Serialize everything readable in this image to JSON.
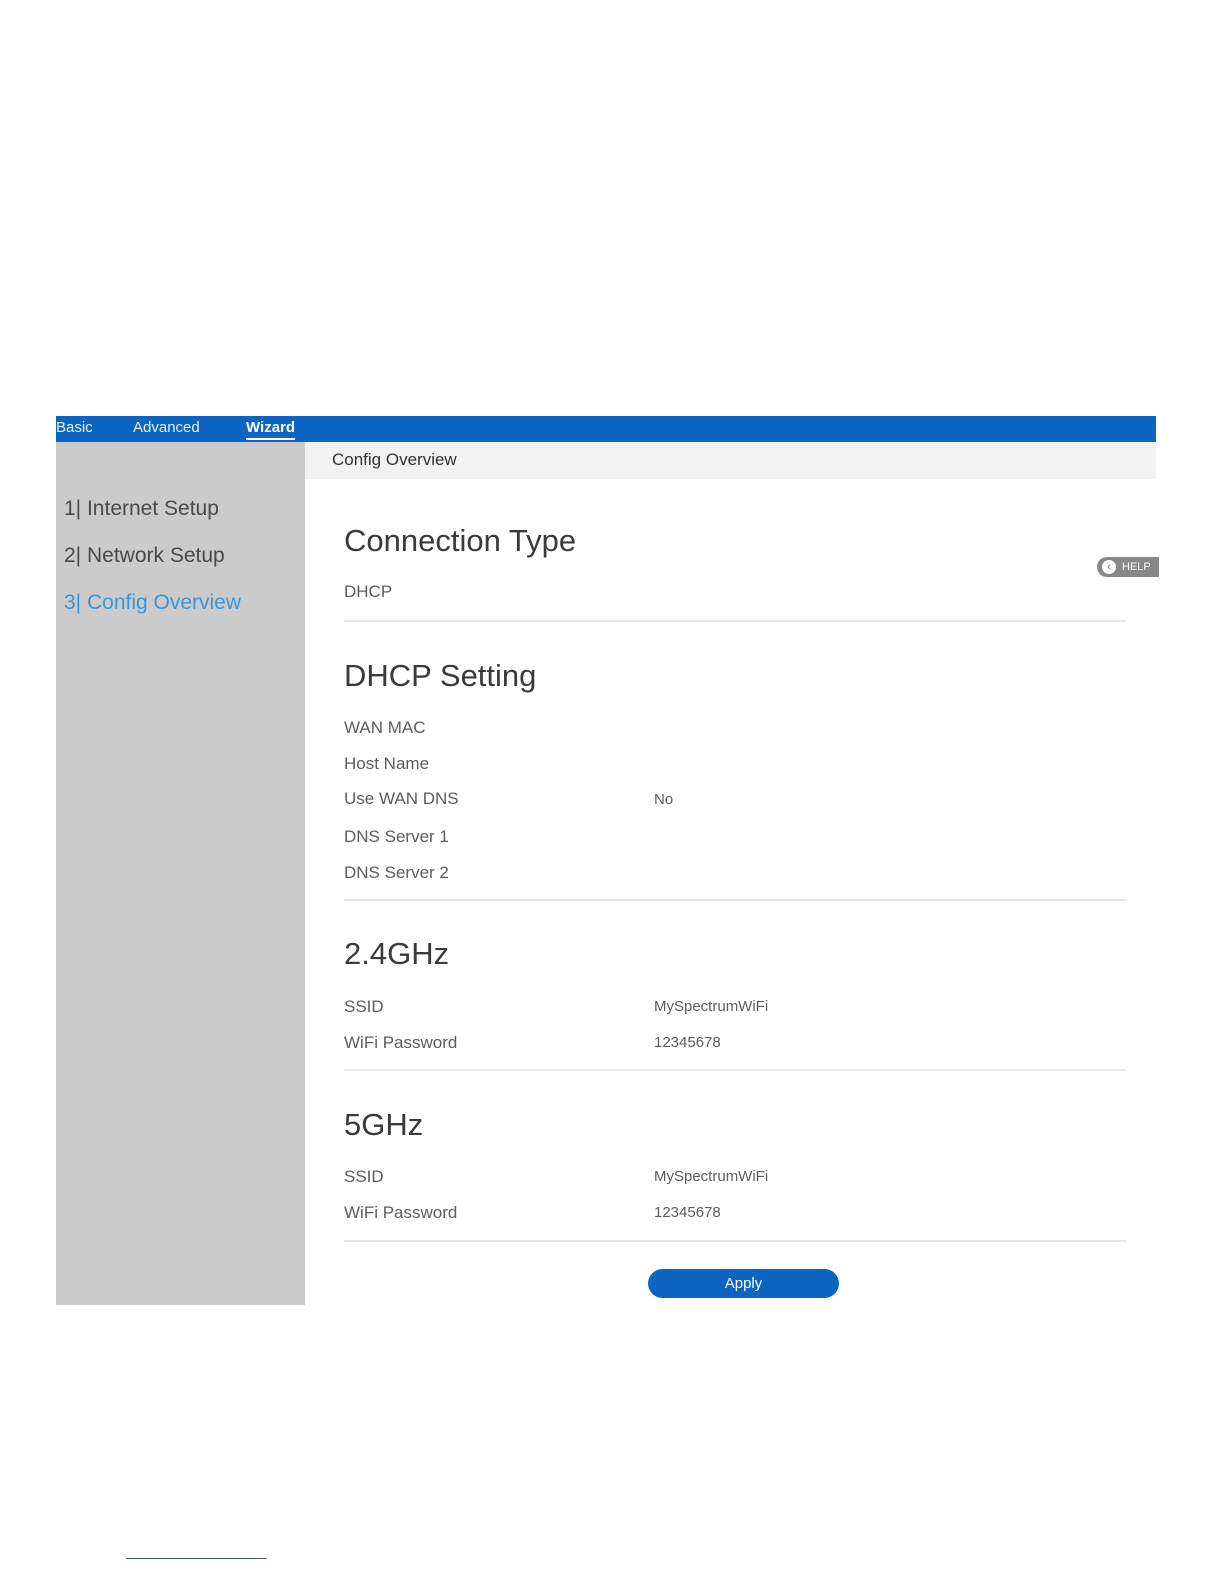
{
  "topnav": {
    "tabs": [
      {
        "label": "Basic"
      },
      {
        "label": "Advanced"
      },
      {
        "label": "Wizard",
        "active": true
      }
    ]
  },
  "sidebar": {
    "steps": [
      {
        "label": "1| Internet Setup"
      },
      {
        "label": "2| Network Setup"
      },
      {
        "label": "3| Config Overview",
        "active": true
      }
    ]
  },
  "panel": {
    "heading": "Config Overview",
    "help_label": "HELP"
  },
  "connection": {
    "title": "Connection Type",
    "value": "DHCP"
  },
  "dhcp": {
    "title": "DHCP Setting",
    "rows": [
      {
        "label": "WAN MAC",
        "value": ""
      },
      {
        "label": "Host Name",
        "value": ""
      },
      {
        "label": "Use WAN DNS",
        "value": "No"
      },
      {
        "label": "DNS Server 1",
        "value": ""
      },
      {
        "label": "DNS Server 2",
        "value": ""
      }
    ]
  },
  "band24": {
    "title": "2.4GHz",
    "rows": [
      {
        "label": "SSID",
        "value": "MySpectrumWiFi"
      },
      {
        "label": "WiFi Password",
        "value": "12345678"
      }
    ]
  },
  "band5": {
    "title": "5GHz",
    "rows": [
      {
        "label": "SSID",
        "value": "MySpectrumWiFi"
      },
      {
        "label": "WiFi Password",
        "value": "12345678"
      }
    ]
  },
  "apply_label": "Apply",
  "colors": {
    "accent": "#0e64c2",
    "sidebar": "#cbcbcb",
    "active_step": "#3d95d6"
  }
}
